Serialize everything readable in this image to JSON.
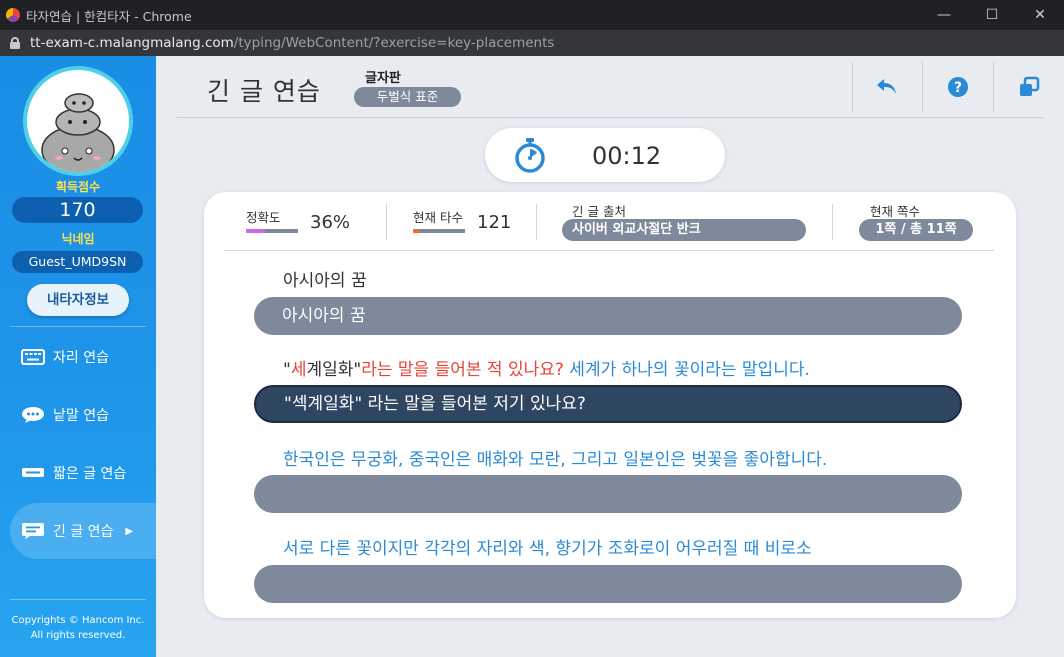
{
  "window": {
    "title": "타자연습 | 한컴타자 - Chrome",
    "url_domain": "tt-exam-c.malangmalang.com",
    "url_path": "/typing/WebContent/?exercise=key-placements"
  },
  "sidebar": {
    "score_label": "획득점수",
    "score": "170",
    "nickname_label": "닉네임",
    "nickname": "Guest_UMD9SN",
    "info_button": "내타자정보",
    "items": [
      {
        "label": "자리 연습",
        "icon": "keyboard-icon"
      },
      {
        "label": "낱말 연습",
        "icon": "speech-bubble-icon"
      },
      {
        "label": "짧은 글 연습",
        "icon": "short-text-icon"
      },
      {
        "label": "긴 글 연습",
        "icon": "long-text-icon"
      }
    ],
    "copyright_line1": "Copyrights © Hancom Inc.",
    "copyright_line2": "All rights reserved."
  },
  "header": {
    "title": "긴 글 연습",
    "keyboard_label": "글자판",
    "keyboard_value": "두벌식 표준",
    "icons": [
      "back-arrow-icon",
      "help-icon",
      "window-icon"
    ]
  },
  "timer": {
    "value": "00:12",
    "icon": "stopwatch-icon"
  },
  "stats": {
    "accuracy_label": "정확도",
    "accuracy_value": "36%",
    "accuracy_fraction": 0.36,
    "speed_label": "현재 타수",
    "speed_value": "121",
    "speed_fraction": 0.12,
    "source_label": "긴 글 출처",
    "source_value": "사이버 외교사절단 반크",
    "page_label": "현재 쪽수",
    "page_value": "1쪽 / 총 11쪽",
    "accuracy_color": "#c86be8",
    "speed_color": "#f07020"
  },
  "lines": [
    {
      "segments": [
        {
          "text": "아시아의 꿈",
          "color": "#333333"
        }
      ],
      "input": "아시아의 꿈"
    },
    {
      "segments": [
        {
          "text": "\"",
          "color": "#333333"
        },
        {
          "text": "세",
          "color": "#e8443a"
        },
        {
          "text": "계일화\"",
          "color": "#333333"
        },
        {
          "text": "라는 말을 들어본 적 있나요?",
          "color": "#e8443a"
        },
        {
          "text": " 세계가 하나의 꽃이라는 말입니다.",
          "color": "#2b8ad6"
        }
      ],
      "input": "\"섹계일화\" 라는 말을 들어본 저기 있나요?"
    },
    {
      "segments": [
        {
          "text": "한국인은 무궁화, 중국인은 매화와 모란, 그리고 일본인은 벚꽃을 좋아합니다.",
          "color": "#2b8ad6"
        }
      ],
      "input": ""
    },
    {
      "segments": [
        {
          "text": "서로 다른 꽃이지만 각각의 자리와 색, 향기가 조화로이 어우러질 때 비로소",
          "color": "#2b8ad6"
        }
      ],
      "input": ""
    }
  ]
}
